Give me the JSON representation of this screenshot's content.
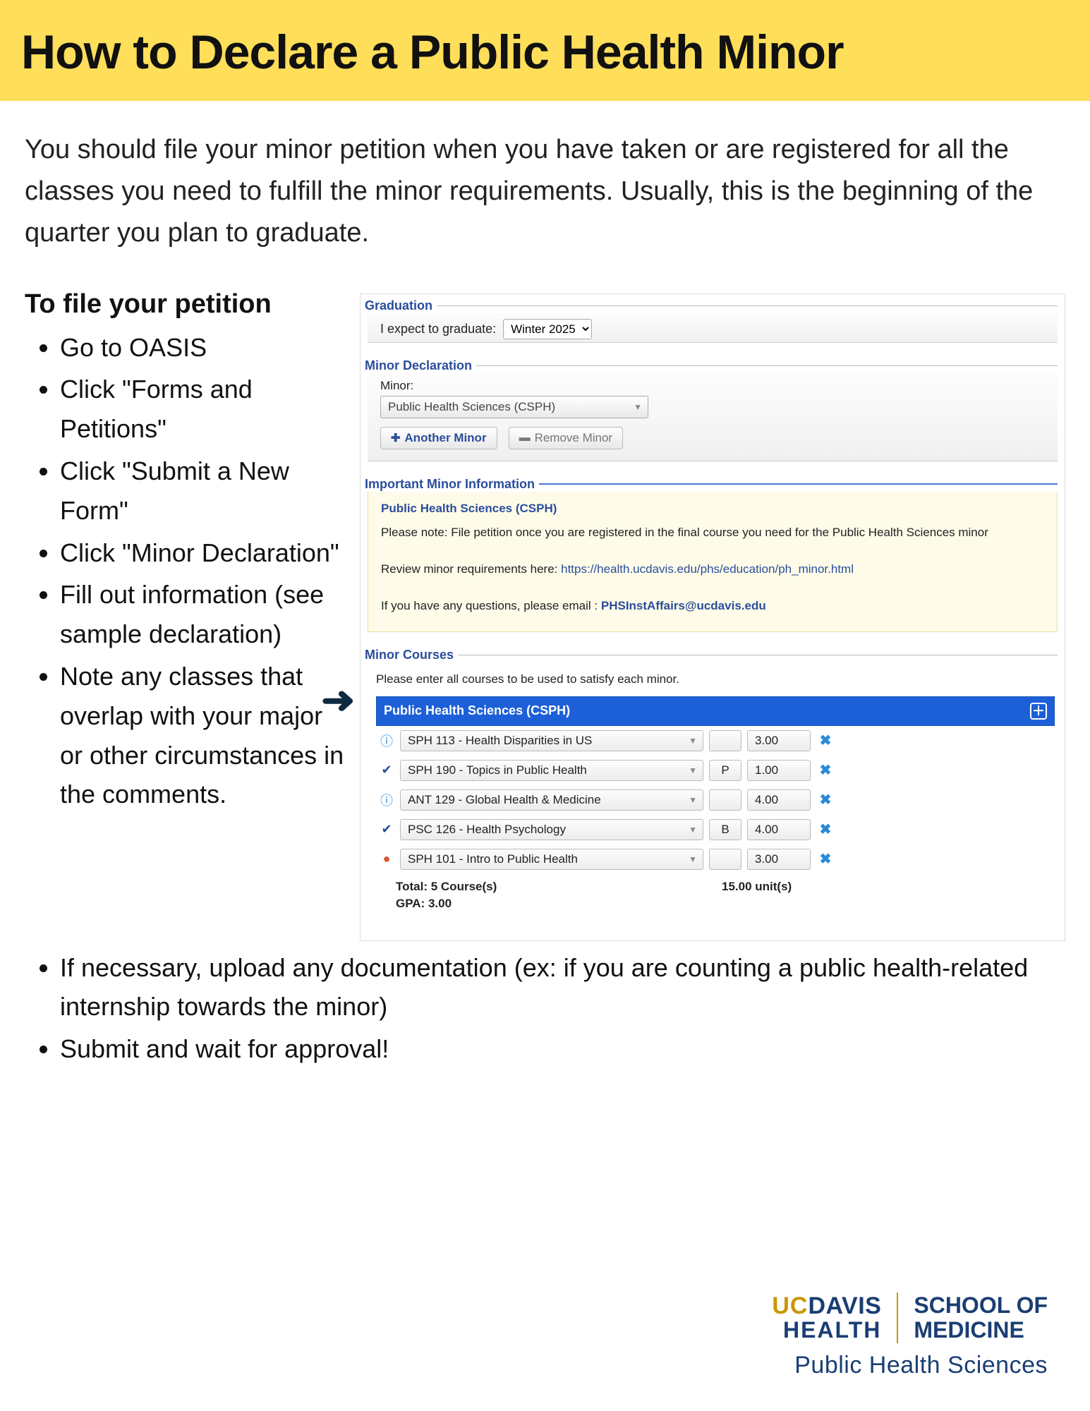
{
  "header": {
    "title": "How to Declare a Public Health Minor"
  },
  "intro": "You should file your minor petition when you have taken or are registered for all the classes you need to fulfill the minor requirements. Usually, this is the beginning of the quarter you plan to graduate.",
  "steps_heading": "To file your petition",
  "steps_left": [
    "Go to OASIS",
    "Click \"Forms and Petitions\"",
    "Click \"Submit a New Form\"",
    "Click \"Minor Declaration\"",
    "Fill out information (see sample declaration)",
    "Note any classes that overlap with your major or other circumstances in the comments."
  ],
  "steps_more": [
    "If necessary, upload any documentation (ex: if you are counting a public health-related internship towards the minor)",
    "Submit and wait for approval!"
  ],
  "oasis": {
    "graduation": {
      "legend": "Graduation",
      "label": "I expect to graduate:",
      "term": "Winter 2025"
    },
    "declaration": {
      "legend": "Minor Declaration",
      "label": "Minor:",
      "selected": "Public Health Sciences (CSPH)",
      "another_btn": "Another Minor",
      "remove_btn": "Remove Minor"
    },
    "info": {
      "legend": "Important Minor Information",
      "title": "Public Health Sciences (CSPH)",
      "note": "Please note: File petition once you are registered in the final course you need for the Public Health Sciences minor",
      "review_prefix": "Review minor requirements here: ",
      "review_link": "https://health.ucdavis.edu/phs/education/ph_minor.html",
      "email_prefix": "If you have any questions, please email : ",
      "email": "PHSInstAffairs@ucdavis.edu"
    },
    "courses": {
      "legend": "Minor Courses",
      "note": "Please enter all courses to be used to satisfy each minor.",
      "group_title": "Public Health Sciences (CSPH)",
      "rows": [
        {
          "status": "info",
          "name": "SPH 113 - Health Disparities in US",
          "grade": "",
          "units": "3.00"
        },
        {
          "status": "check",
          "name": "SPH 190 - Topics in Public Health",
          "grade": "P",
          "units": "1.00"
        },
        {
          "status": "info",
          "name": "ANT 129 - Global Health & Medicine",
          "grade": "",
          "units": "4.00"
        },
        {
          "status": "check",
          "name": "PSC 126 - Health Psychology",
          "grade": "B",
          "units": "4.00"
        },
        {
          "status": "warn",
          "name": "SPH 101 - Intro to Public Health",
          "grade": "",
          "units": "3.00"
        }
      ],
      "total_label": "Total: 5 Course(s)",
      "total_units": "15.00 unit(s)",
      "gpa_label": "GPA: 3.00"
    }
  },
  "footer": {
    "uc": "UC",
    "davis": "DAVIS",
    "health": "HEALTH",
    "school_of": "SCHOOL OF",
    "medicine": "MEDICINE",
    "phs": "Public Health Sciences"
  }
}
